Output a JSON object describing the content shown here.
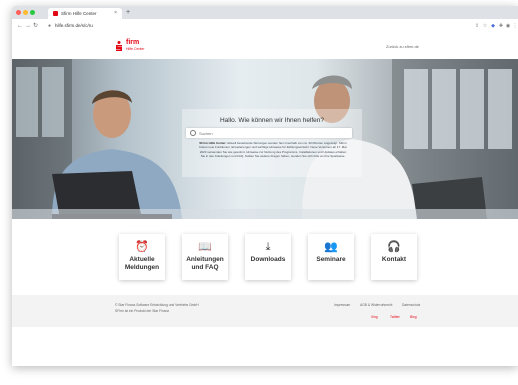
{
  "browser": {
    "tab_title": "Sfirm Hilfe Center",
    "url": "hilfe.sfirm.de/s/c/ru",
    "colors": {
      "close": "#ff5f57",
      "minimize": "#febc2e",
      "maximize": "#28c840"
    }
  },
  "header": {
    "logo_text": "firm",
    "logo_sub": "Hilfe Center",
    "contact_link": "Zurück zu sfirm.de"
  },
  "hero": {
    "title": "Hallo. Wie können wir Ihnen helfen?",
    "search_placeholder": "Suchen",
    "info_lead": "SFirm Hilfe Center:",
    "info_text": "Aktuell bestehende Störungen werden hier innerhalb von ca. 30 Minuten angezeigt. SFirm bietet neue Funktionen, Erweiterungen und wichtige Hinweise für Zahlungsverkehr. Neue Versionen ab 17. Mai 2023 verwenden Sie wie gewohnt. Hinweise zur Nutzung des Programms, Installationen und Updates erhalten Sie in den Anleitungen und FAQ. Sollten Sie weitere Fragen haben, wenden Sie sich bitte an Ihre Sparkasse."
  },
  "tiles": [
    {
      "icon": "alarm-clock-icon",
      "glyph": "⏰",
      "label": "Aktuelle\nMeldungen"
    },
    {
      "icon": "book-icon",
      "glyph": "📖",
      "label": "Anleitungen\nund FAQ"
    },
    {
      "icon": "download-icon",
      "glyph": "⤓",
      "label": "Downloads"
    },
    {
      "icon": "people-icon",
      "glyph": "👥",
      "label": "Seminare"
    },
    {
      "icon": "headset-icon",
      "glyph": "🎧",
      "label": "Kontakt"
    }
  ],
  "footer": {
    "line1": "© Star Finanz-Software Entwicklung und Vertriebs GmbH",
    "line2": "SFirm ist ein Produkt der Star Finanz",
    "links": [
      "Impressum",
      "AGB & Widerrufsrecht",
      "Datenschutz"
    ],
    "social": [
      "Xing",
      "Twitter",
      "Blog"
    ]
  },
  "brand_color": "#e30613"
}
